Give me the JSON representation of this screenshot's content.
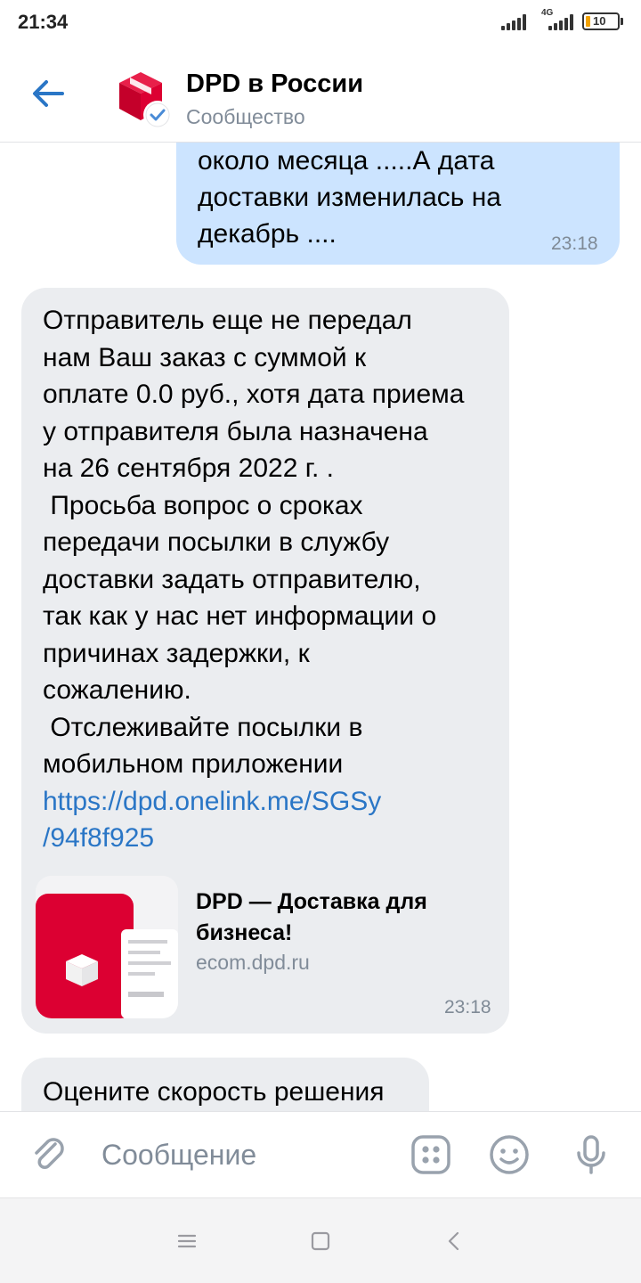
{
  "status_bar": {
    "time": "21:34",
    "network": "4G",
    "battery": "10"
  },
  "header": {
    "title": "DPD в России",
    "subtitle": "Сообщество"
  },
  "messages": [
    {
      "direction": "outgoing",
      "text": "около месяца .....А дата\nдоставки изменилась на\nдекабрь ....",
      "time": "23:18"
    },
    {
      "direction": "incoming",
      "text": "Отправитель еще не передал\nнам Ваш заказ с суммой к\nоплате 0.0 руб., хотя дата приема\nу отправителя была назначена\nна 26 сентября 2022 г. .\n Просьба вопрос о сроках\nпередачи посылки в службу\nдоставки задать отправителю,\nтак как у нас нет информации о\nпричинах задержки, к\nсожалению.\n Отслеживайте посылки в\nмобильном приложении",
      "link": "https://dpd.onelink.me/SGSy\n/94f8f925",
      "card": {
        "title": "DPD — Доставка для бизнеса!",
        "domain": "ecom.dpd.ru"
      },
      "time": "23:18"
    },
    {
      "direction": "incoming",
      "text": "Оцените скорость решения"
    }
  ],
  "composer": {
    "placeholder": "Сообщение"
  },
  "colors": {
    "accent": "#2a76c6",
    "outgoing_bubble": "#cce4ff",
    "incoming_bubble": "#ebedf0",
    "brand_red": "#dc0032"
  },
  "icons": [
    "back-arrow-icon",
    "dpd-logo-icon",
    "verified-icon",
    "attach-icon",
    "apps-icon",
    "emoji-icon",
    "microphone-icon",
    "menu-icon",
    "home-icon",
    "back-icon"
  ]
}
